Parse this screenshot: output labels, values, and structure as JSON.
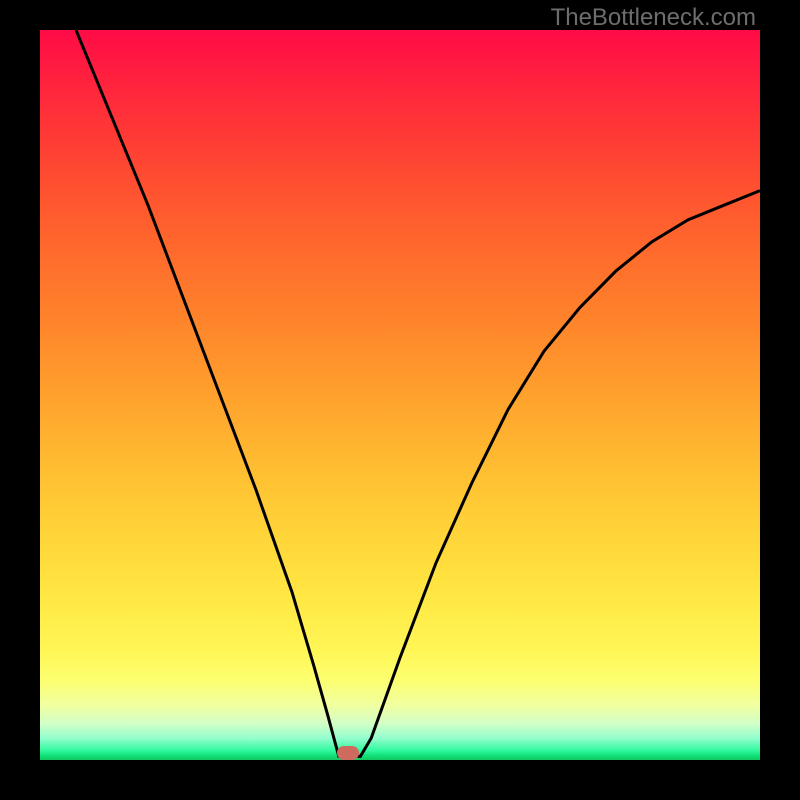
{
  "watermark": "TheBottleneck.com",
  "marker": {
    "x_pct": 42.8,
    "y_pct": 99.0
  },
  "chart_data": {
    "type": "line",
    "title": "",
    "xlabel": "",
    "ylabel": "",
    "xlim": [
      0,
      100
    ],
    "ylim": [
      0,
      100
    ],
    "gradient_axis": "y",
    "gradient": [
      {
        "pos": 0,
        "color": "#11c85f"
      },
      {
        "pos": 0.6,
        "color": "#11e07a"
      },
      {
        "pos": 1.3,
        "color": "#31f99e"
      },
      {
        "pos": 3,
        "color": "#94fece"
      },
      {
        "pos": 5,
        "color": "#d2ffc6"
      },
      {
        "pos": 7.5,
        "color": "#f1ffa0"
      },
      {
        "pos": 11,
        "color": "#fdff6f"
      },
      {
        "pos": 15,
        "color": "#fff656"
      },
      {
        "pos": 21,
        "color": "#ffea46"
      },
      {
        "pos": 28,
        "color": "#ffdb3b"
      },
      {
        "pos": 36,
        "color": "#ffc834"
      },
      {
        "pos": 44,
        "color": "#ffb22f"
      },
      {
        "pos": 52,
        "color": "#ff9b2c"
      },
      {
        "pos": 60,
        "color": "#ff842b"
      },
      {
        "pos": 69,
        "color": "#ff6c2c"
      },
      {
        "pos": 78,
        "color": "#ff5230"
      },
      {
        "pos": 86,
        "color": "#ff3836"
      },
      {
        "pos": 94,
        "color": "#ff1f3f"
      },
      {
        "pos": 100,
        "color": "#ff0b47"
      }
    ],
    "series": [
      {
        "name": "bottleneck-curve",
        "x": [
          5,
          10,
          15,
          20,
          25,
          30,
          35,
          38,
          40,
          41.5,
          44.5,
          46,
          50,
          55,
          60,
          65,
          70,
          75,
          80,
          85,
          90,
          95,
          100
        ],
        "y": [
          100,
          88,
          76,
          63,
          50,
          37,
          23,
          13,
          6,
          0.5,
          0.5,
          3,
          14,
          27,
          38,
          48,
          56,
          62,
          67,
          71,
          74,
          76,
          78
        ]
      }
    ],
    "marker": {
      "x": 42.8,
      "y": 1.0,
      "color": "#cf6a5e"
    }
  }
}
